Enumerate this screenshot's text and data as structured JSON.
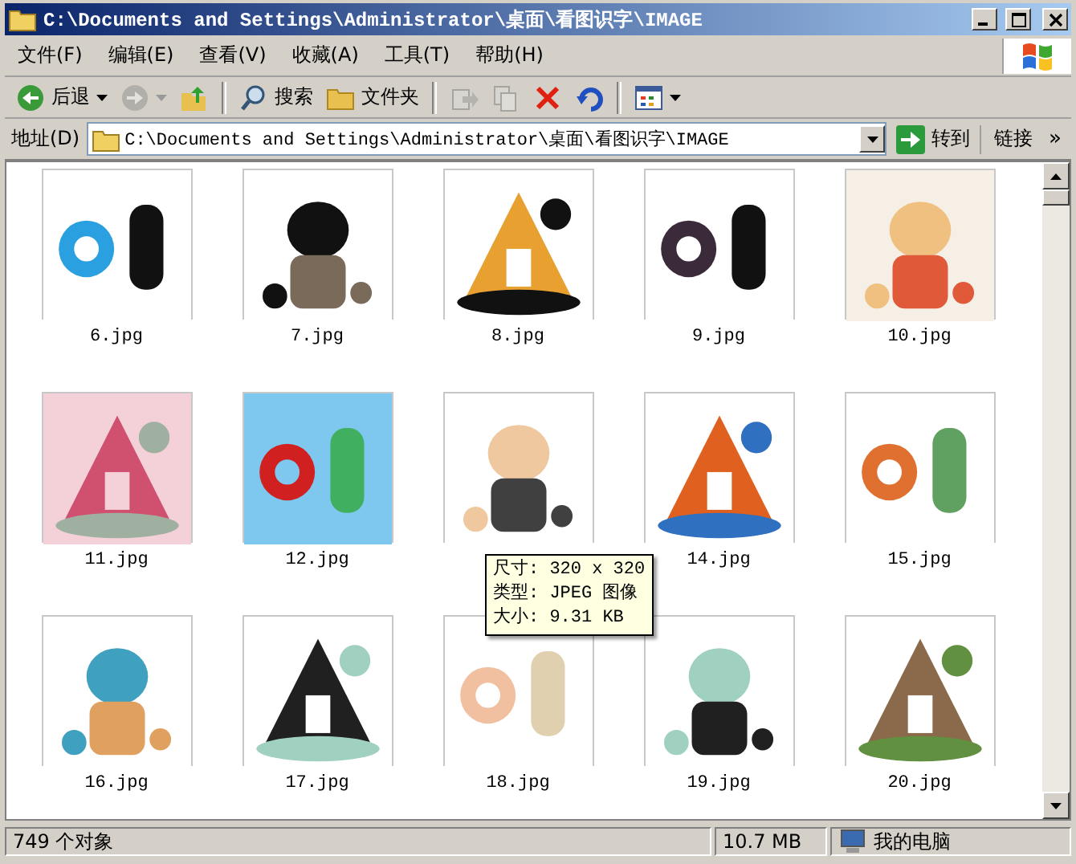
{
  "window": {
    "title": "C:\\Documents and Settings\\Administrator\\桌面\\看图识字\\IMAGE"
  },
  "menu": [
    "文件(F)",
    "编辑(E)",
    "查看(V)",
    "收藏(A)",
    "工具(T)",
    "帮助(H)"
  ],
  "toolbar": [
    {
      "kind": "back",
      "label": "后退",
      "disabled": false
    },
    {
      "kind": "forward",
      "disabled": true
    },
    {
      "kind": "up",
      "disabled": false
    },
    {
      "kind": "separator"
    },
    {
      "kind": "search",
      "label": "搜索",
      "disabled": false
    },
    {
      "kind": "folders",
      "label": "文件夹",
      "disabled": false
    },
    {
      "kind": "separator"
    },
    {
      "kind": "move",
      "disabled": true
    },
    {
      "kind": "copy",
      "disabled": true
    },
    {
      "kind": "delete",
      "disabled": false
    },
    {
      "kind": "undo",
      "disabled": false
    },
    {
      "kind": "separator"
    },
    {
      "kind": "views",
      "disabled": false
    }
  ],
  "address": {
    "label": "地址(D)",
    "value": "C:\\Documents and Settings\\Administrator\\桌面\\看图识字\\IMAGE",
    "go": "转到",
    "links": "链接",
    "more": "»"
  },
  "items": [
    {
      "kind": "picture",
      "label": "6.jpg"
    },
    {
      "kind": "picture",
      "label": "7.jpg"
    },
    {
      "kind": "picture",
      "label": "8.jpg"
    },
    {
      "kind": "picture",
      "label": "9.jpg"
    },
    {
      "kind": "picture",
      "label": "10.jpg"
    },
    {
      "kind": "picture",
      "label": "11.jpg"
    },
    {
      "kind": "picture",
      "label": "12.jpg"
    },
    {
      "kind": "picture"
    },
    {
      "kind": "picture",
      "label": "14.jpg"
    },
    {
      "kind": "picture",
      "label": "15.jpg"
    },
    {
      "kind": "picture",
      "label": "16.jpg"
    },
    {
      "kind": "picture",
      "label": "17.jpg"
    },
    {
      "kind": "picture",
      "label": "18.jpg"
    },
    {
      "kind": "picture",
      "label": "19.jpg"
    },
    {
      "kind": "picture",
      "label": "20.jpg"
    }
  ],
  "tooltip": {
    "lines": [
      "尺寸: 320 x 320",
      "类型: JPEG 图像",
      "大小: 9.31 KB"
    ]
  },
  "status": {
    "count": "749 个对象",
    "size": "10.7 MB",
    "zone": "我的电脑"
  }
}
